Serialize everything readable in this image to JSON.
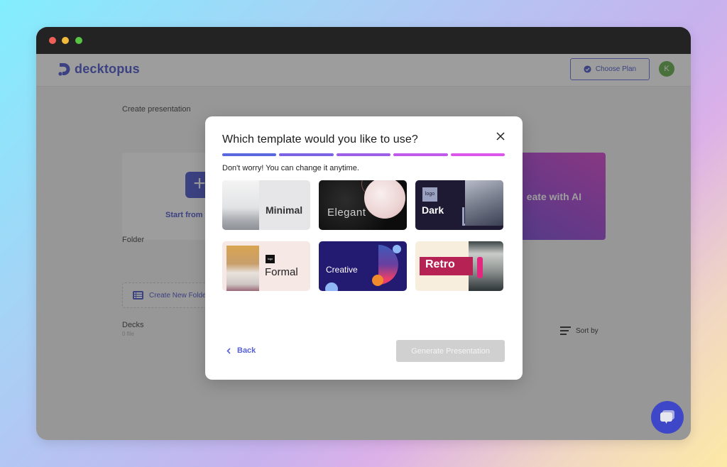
{
  "window": {
    "traffic_lights": [
      "close",
      "minimize",
      "zoom"
    ]
  },
  "header": {
    "brand": "decktopus",
    "choose_plan_label": "Choose Plan",
    "avatar_initial": "K"
  },
  "dashboard": {
    "create_presentation_label": "Create presentation",
    "start_from_label": "Start from",
    "create_with_ai_label": "eate with AI",
    "folder_label": "Folder",
    "create_new_folder_label": "Create New Folde",
    "decks_label": "Decks",
    "decks_count": "0 file",
    "sort_by_label": "Sort by"
  },
  "modal": {
    "title": "Which template would you like to use?",
    "subtitle": "Don't worry! You can change it anytime.",
    "progress": {
      "steps_total": 5,
      "steps_completed": 5,
      "colors": [
        "#5a68e0",
        "#7c63e4",
        "#9e5fe7",
        "#bf5aea",
        "#dd56ec"
      ]
    },
    "templates": [
      {
        "name": "Minimal"
      },
      {
        "name": "Elegant"
      },
      {
        "name": "Dark",
        "logo_text": "logo"
      },
      {
        "name": "Formal",
        "logo_text": "logo"
      },
      {
        "name": "Creative"
      },
      {
        "name": "Retro"
      }
    ],
    "back_label": "Back",
    "generate_label": "Generate Presentation"
  },
  "colors": {
    "brand": "#3d47c8",
    "avatar": "#58a63a",
    "disabled_button": "#d0d0d0"
  }
}
